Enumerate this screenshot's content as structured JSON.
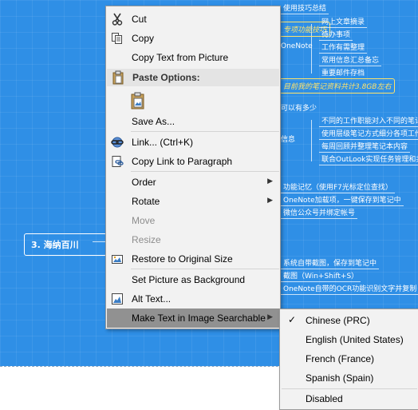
{
  "background": {
    "nodes": [
      "使用技巧总结",
      "专项功能技巧",
      "OneNote",
      "网上文章摘录",
      "待办事项",
      "工作有需整理",
      "常用信息汇总备忘",
      "重要邮件存档",
      "目前我的笔记资料共计3.8GB左右",
      "可以有多少",
      "不同的工作职能对入不同的笔记",
      "使用层级笔记方式细分各项工作",
      "每周回顾并整理笔记本内容",
      "联合OutLook实现任务管理和共享",
      "信息",
      "功能记忆（使用F7光标定位查找）",
      "OneNote加载项，一键保存到笔记中",
      "微信公众号并绑定帐号",
      "系统自带截图，保存到笔记中",
      "截图（Win+Shift+S）",
      "OneNote自带的OCR功能识别文字并复制"
    ],
    "branch_label": "3. 海纳百川"
  },
  "context_menu": {
    "items": [
      {
        "label": "Cut",
        "icon": "scissors-icon"
      },
      {
        "label": "Copy",
        "icon": "copy-icon"
      },
      {
        "label": "Copy Text from Picture",
        "icon": ""
      },
      {
        "header": "Paste Options:",
        "icon": "clipboard-icon"
      },
      {
        "label": "",
        "icon": "paste-picture-icon"
      },
      {
        "label": "Save As...",
        "icon": ""
      },
      {
        "label": "Link...  (Ctrl+K)",
        "icon": "link-icon"
      },
      {
        "label": "Copy Link to Paragraph",
        "icon": "copy-link-icon"
      },
      {
        "label": "Order",
        "icon": "",
        "submenu": true
      },
      {
        "label": "Rotate",
        "icon": "",
        "submenu": true
      },
      {
        "label": "Move",
        "icon": "",
        "disabled": true
      },
      {
        "label": "Resize",
        "icon": "",
        "disabled": true
      },
      {
        "label": "Restore to Original Size",
        "icon": "restore-size-icon"
      },
      {
        "label": "Set Picture as Background",
        "icon": ""
      },
      {
        "label": "Alt Text...",
        "icon": "alt-text-icon"
      },
      {
        "label": "Make Text in Image Searchable",
        "icon": "",
        "submenu": true,
        "highlighted": true
      }
    ],
    "submenu_arrow": "▶"
  },
  "ocr_language_submenu": {
    "checkmark": "✓",
    "items": [
      {
        "label": "Chinese (PRC)",
        "checked": true
      },
      {
        "label": "English (United States)"
      },
      {
        "label": "French (France)"
      },
      {
        "label": "Spanish (Spain)"
      },
      {
        "label": "Disabled"
      }
    ]
  }
}
